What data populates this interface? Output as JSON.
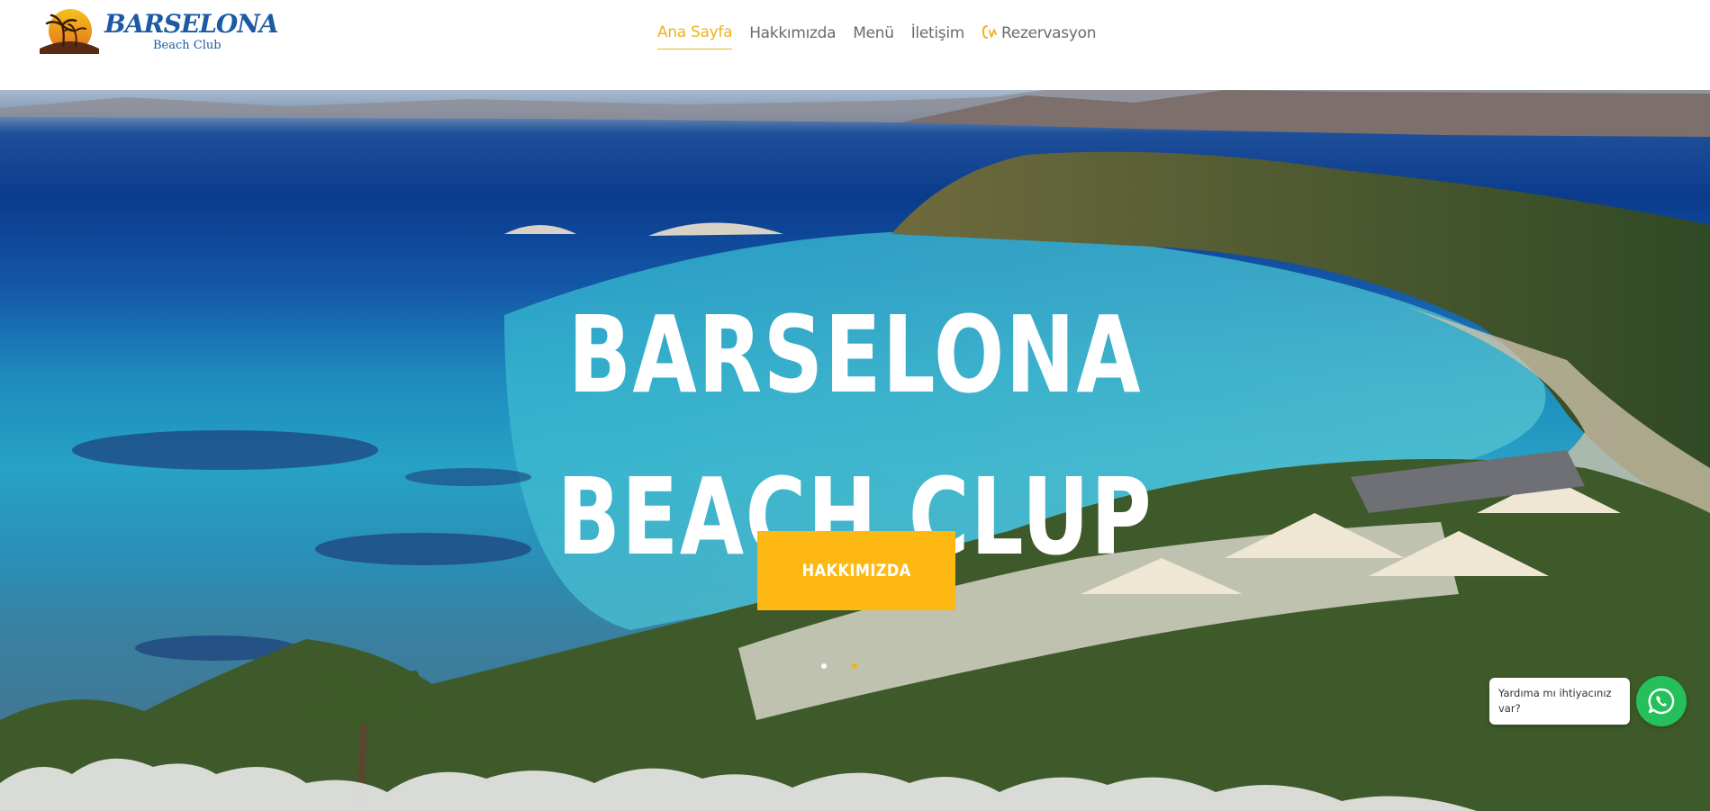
{
  "brand": {
    "logo_word": "BARSELONA",
    "logo_sub": "Beach Club"
  },
  "nav": {
    "items": [
      {
        "label": "Ana Sayfa",
        "active": true
      },
      {
        "label": "Hakkımızda",
        "active": false
      },
      {
        "label": "Menü",
        "active": false
      },
      {
        "label": "İletişim",
        "active": false
      },
      {
        "label": "Rezervasyon",
        "active": false
      }
    ]
  },
  "hero": {
    "title_line1": "BARSELONA",
    "title_line2": "BEACH CLUP",
    "button_label": "HAKKIMIZDA",
    "slides": 2,
    "active_slide": 2
  },
  "help": {
    "bubble_text": "Yardıma mı ihtiyacınız var?"
  },
  "icons": {
    "reservation": "reservation-icon",
    "whatsapp": "whatsapp-icon"
  },
  "colors": {
    "accent": "#f1b21c",
    "button": "#fdb813",
    "nav_text": "#6b6b6b",
    "logo_blue": "#1c5aa3",
    "whatsapp": "#25c05a"
  }
}
